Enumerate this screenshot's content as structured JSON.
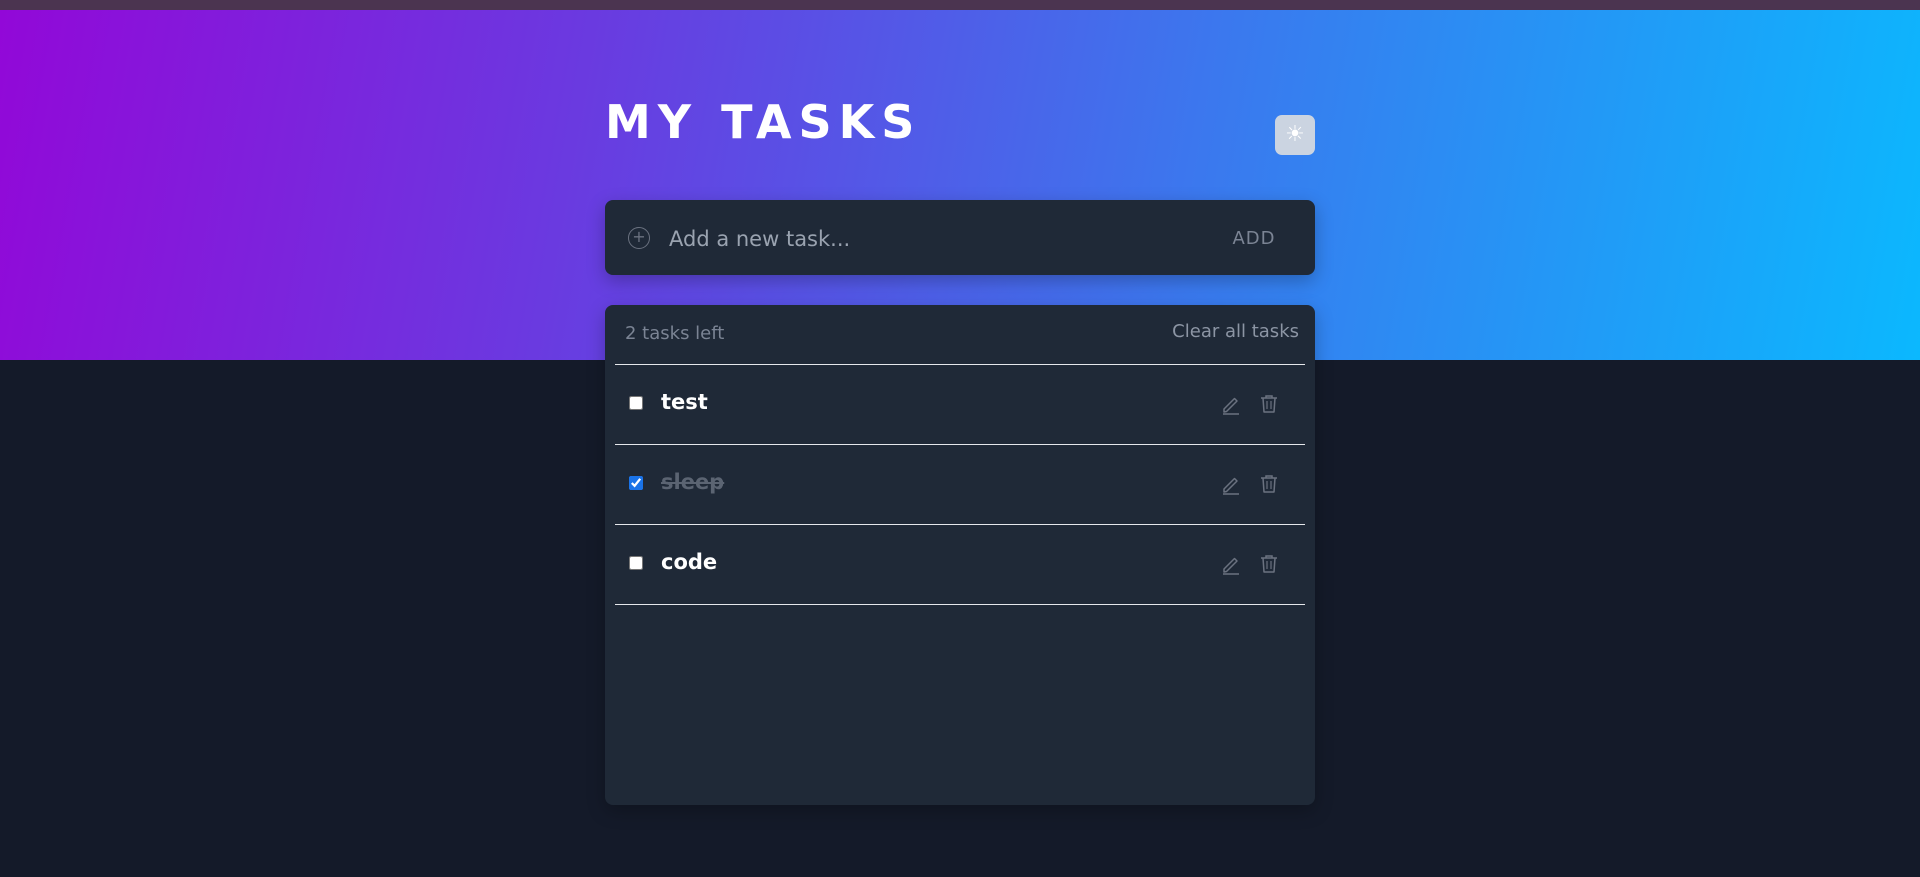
{
  "app": {
    "title": "MY TASKS",
    "theme_toggle_icon": "☀"
  },
  "colors": {
    "gradient_start": "#9208d8",
    "gradient_end": "#0bb8fe",
    "background": "#141a29",
    "card": "#1f2937",
    "checkbox_accent": "#1a73e8"
  },
  "new_task": {
    "icon": "plus-circle-icon",
    "placeholder": "Add a new task...",
    "value": "",
    "add_label": "ADD"
  },
  "list": {
    "tasks_left_label": "2 tasks left",
    "clear_label": "Clear all tasks",
    "tasks": [
      {
        "text": "test",
        "completed": false
      },
      {
        "text": "sleep",
        "completed": true
      },
      {
        "text": "code",
        "completed": false
      }
    ]
  },
  "icons": {
    "edit": "pencil-icon",
    "delete": "trash-icon",
    "theme": "sun-icon"
  }
}
